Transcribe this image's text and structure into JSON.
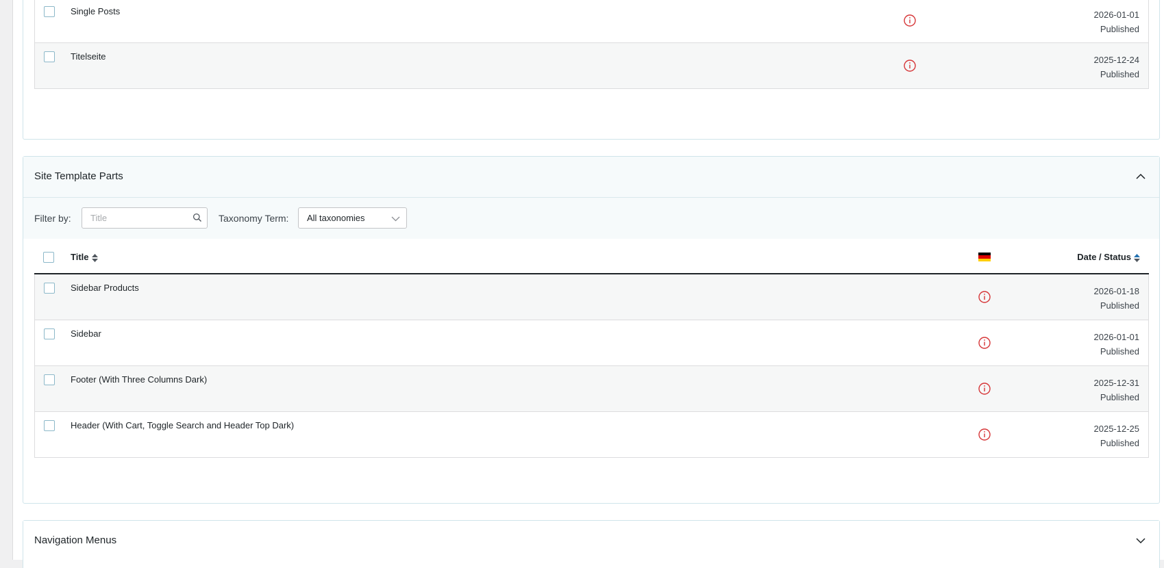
{
  "colors": {
    "accent_border": "#cfe4ea",
    "panel_header_bg": "#f6fafb",
    "info_icon": "#d63638",
    "checkbox_border": "#8cb8c9"
  },
  "top_section": {
    "rows": [
      {
        "title": "Single Posts",
        "date": "2026-01-01",
        "status": "Published",
        "icon": "info-circle-icon"
      },
      {
        "title": "Titelseite",
        "date": "2025-12-24",
        "status": "Published",
        "icon": "info-circle-icon"
      }
    ]
  },
  "parts_section": {
    "title": "Site Template Parts",
    "toggle_icon": "chevron-up-icon",
    "filter": {
      "label": "Filter by:",
      "search_placeholder": "Title",
      "search_value": "",
      "taxonomy_label": "Taxonomy Term:",
      "taxonomy_value": "All taxonomies"
    },
    "columns": {
      "title": "Title",
      "language_flag": "german-flag-icon",
      "date_status": "Date / Status"
    },
    "rows": [
      {
        "title": "Sidebar Products",
        "date": "2026-01-18",
        "status": "Published",
        "icon": "info-circle-icon"
      },
      {
        "title": "Sidebar",
        "date": "2026-01-01",
        "status": "Published",
        "icon": "info-circle-icon"
      },
      {
        "title": "Footer (With Three Columns Dark)",
        "date": "2025-12-31",
        "status": "Published",
        "icon": "info-circle-icon"
      },
      {
        "title": "Header (With Cart, Toggle Search and Header Top Dark)",
        "date": "2025-12-25",
        "status": "Published",
        "icon": "info-circle-icon"
      }
    ]
  },
  "nav_section": {
    "title": "Navigation Menus",
    "toggle_icon": "chevron-down-icon"
  }
}
